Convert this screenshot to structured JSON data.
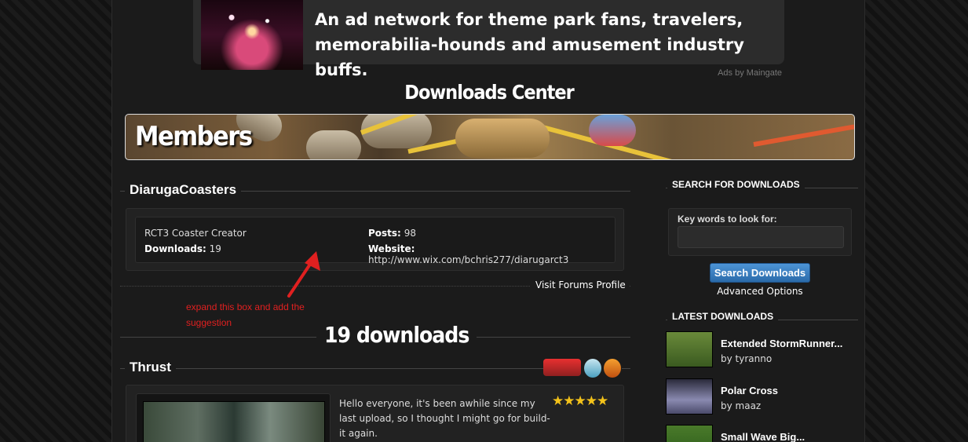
{
  "ad": {
    "text": "An ad network for theme park fans, travelers, memorabilia-hounds and amusement industry buffs.",
    "credit": "Ads by Maingate"
  },
  "center_title": "Downloads Center",
  "banner_title": "Members",
  "member": {
    "name": "DiarugaCoasters",
    "role": "RCT3 Coaster Creator",
    "downloads_label": "Downloads:",
    "downloads_value": "19",
    "posts_label": "Posts:",
    "posts_value": "98",
    "website_label": "Website:",
    "website_value": "http://www.wix.com/bchris277/diarugarct3",
    "visit_profile": "Visit Forums Profile"
  },
  "annotation": "expand this box and add the suggestion",
  "downloads_count": "19 downloads",
  "download": {
    "title": "Thrust",
    "description": "Hello everyone, it's been awhile since my last upload, so I thought I might go for build-it again.",
    "stars": "★★★★★"
  },
  "search": {
    "heading": "SEARCH FOR DOWNLOADS",
    "label": "Key words to look for:",
    "placeholder": "",
    "button": "Search Downloads",
    "advanced": "Advanced Options"
  },
  "latest": {
    "heading": "LATEST DOWNLOADS",
    "items": [
      {
        "title": "Extended StormRunner...",
        "by": "by tyranno"
      },
      {
        "title": "Polar Cross",
        "by": "by maaz"
      },
      {
        "title": "Small Wave Big...",
        "by": ""
      }
    ]
  },
  "colors": {
    "background": "#1b1b1b",
    "button": "#3a82c4",
    "annotation": "#e02020",
    "stars": "#f3c21a"
  }
}
